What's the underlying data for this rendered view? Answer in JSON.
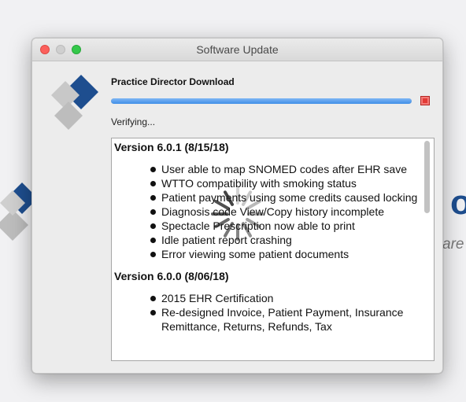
{
  "window": {
    "title": "Software Update"
  },
  "download": {
    "heading": "Practice Director Download",
    "progress_fraction": 1.0,
    "status": "Verifying..."
  },
  "background": {
    "text_or": "or",
    "text_are": "are"
  },
  "release_notes": [
    {
      "version": "Version 6.0.1 (8/15/18)",
      "items": [
        "User able to map SNOMED codes after EHR save",
        "WTTO compatibility with smoking status",
        "Patient payments using some credits caused locking",
        "Diagnosis code View/Copy history incomplete",
        "Spectacle Prescription now able to print",
        "Idle patient report crashing",
        "Error viewing some patient documents"
      ]
    },
    {
      "version": "Version 6.0.0 (8/06/18)",
      "items": [
        "2015 EHR Certification",
        "Re-designed Invoice, Patient Payment, Insurance Remittance, Returns, Refunds, Tax"
      ]
    }
  ],
  "colors": {
    "logo_blue": "#1e4e8f",
    "logo_gray": "#bdbdbd",
    "progress": "#3f8fe8",
    "stop": "#e23a36"
  }
}
